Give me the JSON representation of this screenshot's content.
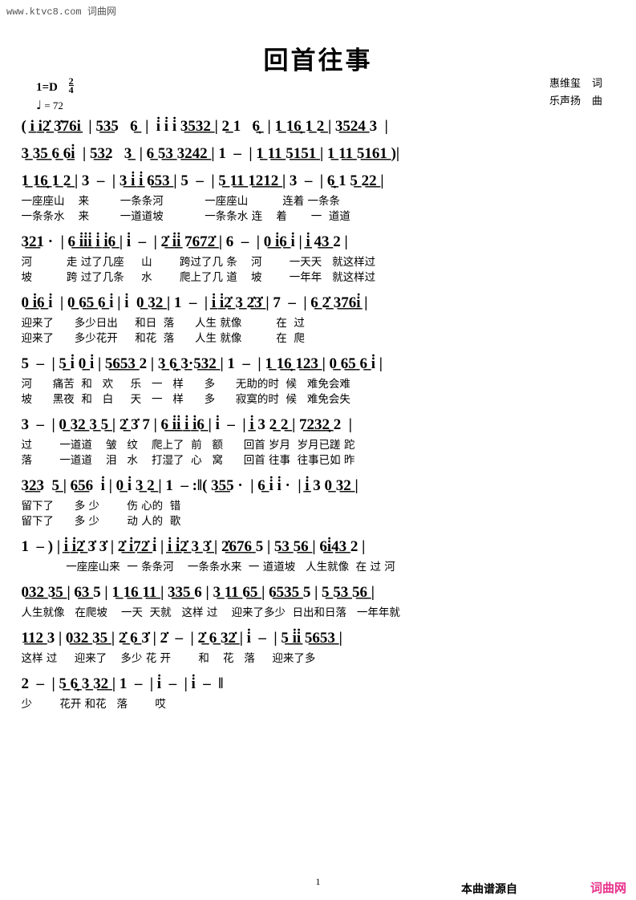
{
  "watermark": {
    "top": "www.ktvc8.com",
    "top_cn": "词曲网",
    "footer_note": "本曲谱源自",
    "footer_logo": "词曲网"
  },
  "header": {
    "title": "回首往事",
    "key_label": "1=D",
    "meter_numerator": "2",
    "meter_denominator": "4",
    "tempo_note": "♩",
    "tempo_text": "= 72",
    "lyricist": "惠维玺",
    "lyricist_role": "词",
    "composer": "乐声扬",
    "composer_role": "曲"
  },
  "page_number": "1",
  "score": {
    "systems": [
      {
        "id": "system-1",
        "notes": "( i̲ i̲2̲̇ 3̲̇7̲6̲i̲  | 5̲3̲5   6̲  |  i̇ i̇ i̇ 3̲5̲3̲2̲ | 2̲ 1   6̲̣  | 1̲ 1̲6̲̣ 1̲ 2̲ | 3̲5̲2̲4̲ 3  |",
        "lyrics": []
      },
      {
        "id": "system-2",
        "notes": "3̲ 3̲5̲ 6̲ 6̲i̇  | 5̲3̲2   3̲  | 6̲ 5̲3̲ 3̲2̲4̲2̲ | 1  –  | 1̲ 1̲1̲ 5̲1̲5̲1̲ | 1̲ 1̲1̲ 5̲1̲6̲1̲ )|",
        "lyrics": []
      },
      {
        "id": "system-3",
        "notes": "1̲ 1̲6̲̣ 1̲ 2̲ | 3  –  | 3̲ i̲̇ i̲̇ 6̲5̲3̲ | 5  –  | 5̲ 1̲1̲ 1̲2̲1̲2̲ | 3  –  | 6̲̣ 1 5̲ 2̲2̲ |",
        "lyrics": [
          "一座座山    来         一条条河            一座座山          连着 一条条",
          "一条条水    来         一道道坡            一条条水 连    着       一  道道"
        ]
      },
      {
        "id": "system-4",
        "notes": "3̲2̲1 ·  | 6̲ i̲̇i̲̇i̲̇ i̲̇ i̲̇6̲ | i̇  –  | 2̲̇ i̲̇i̲̇ 7̲6̲7̲2̲̇ | 6  –  | 0̲ i̲̇6̲ i̇ | i̲̇ 4̲3̲ 2 |",
        "lyrics": [
          "河          走 过了几座     山        跨过了几 条    河        一天天   就这样过",
          "坡          跨 过了几条     水        爬上了几 道    坡        一年年   就这样过"
        ]
      },
      {
        "id": "system-5",
        "notes": "0̲ i̲̇6̲ i̇  | 0̲ 6̲5̲ 6̲ i̇ | i̇  0̲ 3̲2̲ | 1  –  | i̲̇ i̲̇2̲̇ 3̲ 2̲̇3̲̇ | 7  –  | 6̲ 2̲̇ 3̲7̲6̲i̲̇ |",
        "lyrics": [
          "迎来了      多少日出     和日  落      人生 就像          在  过",
          "迎来了      多少花开     和花  落      人生 就像          在  爬"
        ]
      },
      {
        "id": "system-6",
        "notes": "5  –  | 5̲ i̇ 0̲ i̇ | 5̲6̲5̲3̲ 2 | 3̲ 6̲̣ 3̲·5̲3̲2̲ | 1  –  | 1̲ 1̲6̲̣ 1̲2̲3̲ | 0̲ 6̲5̲ 6̲ i̇ |",
        "lyrics": [
          "河      痛苦  和   欢     乐   一   样      多      无助的时  候   难免会难",
          "坡      黑夜  和   白     天   一   样      多      寂寞的时  候   难免会失"
        ]
      },
      {
        "id": "system-7",
        "notes": "3  –  | 0̲ 3̲2̲ 3̲ 5̲ | 2̲̇ 3̇ 7 | 6̲ i̲̇i̲̇ i̲̇ i̲̇6̲ | i̇  –  | i̲̇ 3 2̲ 2̲ | 7̲2̲3̲2̲̣ 2  |",
        "lyrics": [
          "过        一道道    皱   纹    爬上了  前   额      回首 岁月  岁月已蹉 跎",
          "落        一道道    泪   水    打湿了  心   窝      回首 往事  往事已如 昨"
        ]
      },
      {
        "id": "system-8",
        "notes": "3̲2̲3  5̲ | 6̲5̲6  i̇ | 0̲ i̇ 3̲ 2̲ | 1  – :‖( 3̲5̲5 ·  | 6̲ i̇ i̇ ·  | i̲̇ 3 0̲ 3̲2̲ |",
        "lyrics": [
          "留下了      多 少        伤 心的  错",
          "留下了      多 少        动 人的  歌"
        ]
      },
      {
        "id": "system-9",
        "notes": "1  – ) | i̲̇ i̲̇2̲̇ 3̇ 3̇ | 2̲̇ i̲̇7̲2̲̇ i̇ | i̲̇ i̲̇2̲̇ 3̲ 3̲̇ | 2̲̇6̲7̲6̲ 5 | 5̲3̲ 5̲6̲ | 6̲i̲̇4̲3̲ 2 |",
        "lyrics": [
          "             一座座山来  一 条条河    一条条水来  一 道道坡   人生就像  在 过 河"
        ]
      },
      {
        "id": "system-10",
        "notes": "0̲3̲2̲ 3̲5̲ | 6̲3̲ 5 | 1̲ 1̲6̲ 1̲1̲ | 3̲3̲5̲ 6 | 3̲ 1̲1̲ 6̲5̲ | 6̲5̲3̲5̲ 5 | 5̲ 5̲3̲ 5̲6̲ |",
        "lyrics": [
          "人生就像   在爬坡    一天  天就   这样 过    迎来了多少  日出和日落   一年年就"
        ]
      },
      {
        "id": "system-11",
        "notes": "1̲1̲2̲ 3 | 0̲3̲2̲ 3̲5̲ | 2̲̇ 6̲ 3̇ | 2̇  –  | 2̲̇ 6̲ 3̲2̲̇ | i̇  –  | 5̲ i̲̇i̲̇ 5̲6̲5̲3̲ |",
        "lyrics": [
          "这样 过     迎来了    多少 花 开        和    花   落     迎来了多"
        ]
      },
      {
        "id": "system-12",
        "notes": "2  –  | 5̲ 6̲̣ 3̲ 3̲2̲ | 1  –  | i̇  –  | i̇  –  ‖",
        "lyrics": [
          "少        花开 和花   落        哎"
        ]
      }
    ]
  }
}
